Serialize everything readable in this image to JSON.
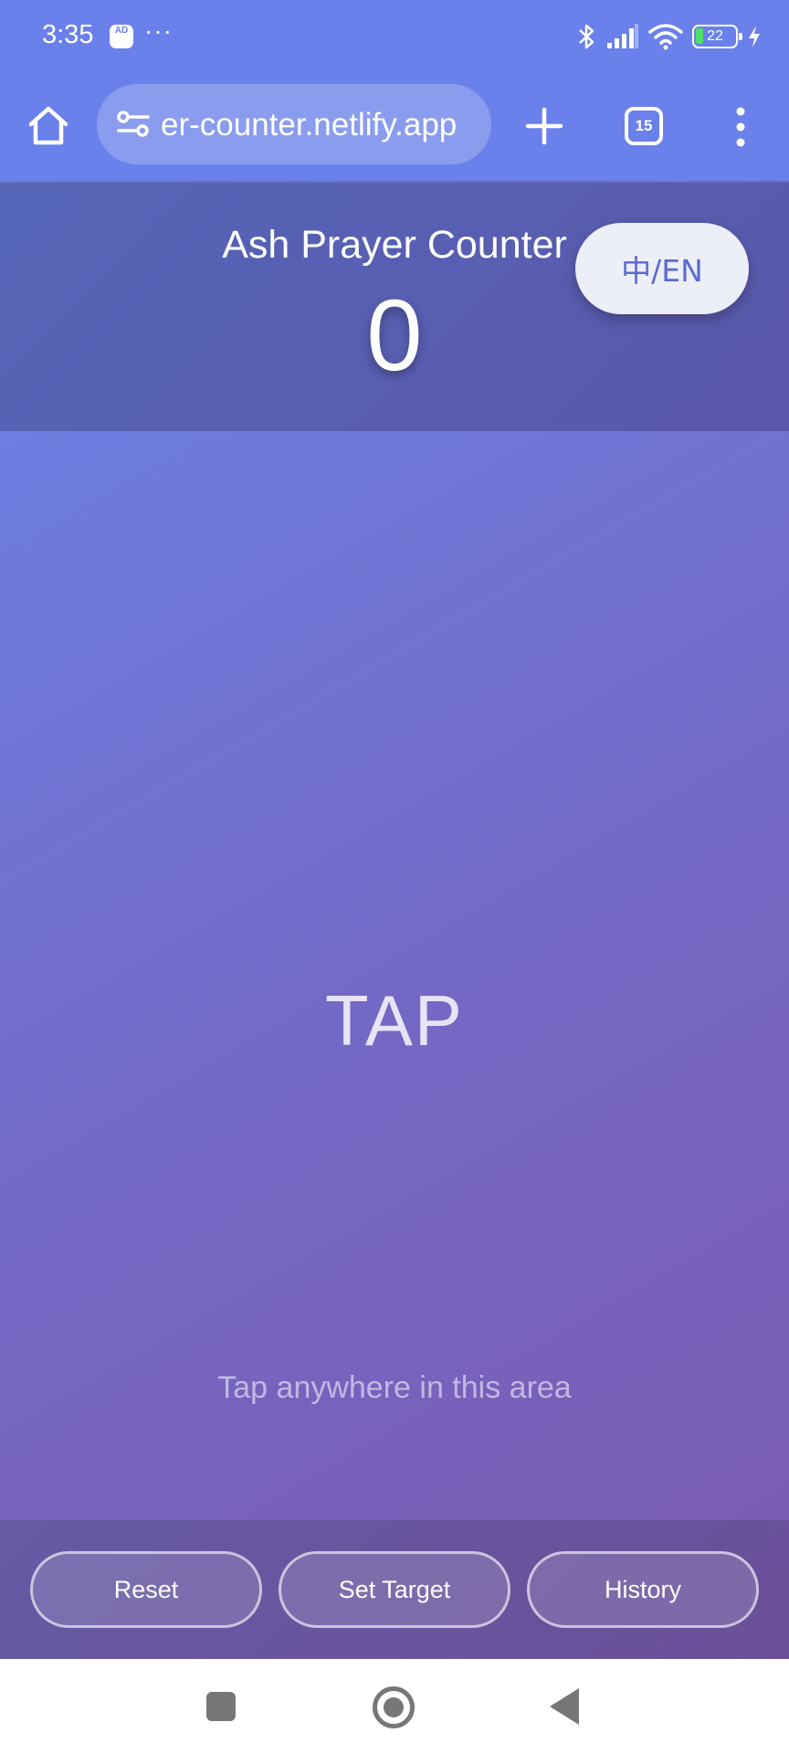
{
  "status_bar": {
    "time": "3:35",
    "ad_badge": "AD",
    "more_dots": "···",
    "battery_level": "22",
    "icons": [
      "ad-blocker-icon",
      "bluetooth-icon",
      "signal-icon",
      "wifi-icon",
      "battery-icon",
      "charging-icon"
    ]
  },
  "browser": {
    "url": "er-counter.netlify.app",
    "tab_count": "15",
    "icons": [
      "home-icon",
      "tune-icon",
      "plus-icon",
      "tabs-icon",
      "more-vert-icon"
    ]
  },
  "app": {
    "title": "Ash Prayer Counter",
    "count": "0",
    "lang_toggle": "中/EN",
    "tap_label": "TAP",
    "tap_hint": "Tap anywhere in this area"
  },
  "actions": {
    "reset": "Reset",
    "set_target": "Set Target",
    "history": "History"
  },
  "colors": {
    "toolbar": "#6a80ea",
    "header": "#5566b8",
    "tap_area_start": "#6c7ee0",
    "tap_area_end": "#7a5cb4",
    "lang_button_text": "#5a6ad0"
  }
}
